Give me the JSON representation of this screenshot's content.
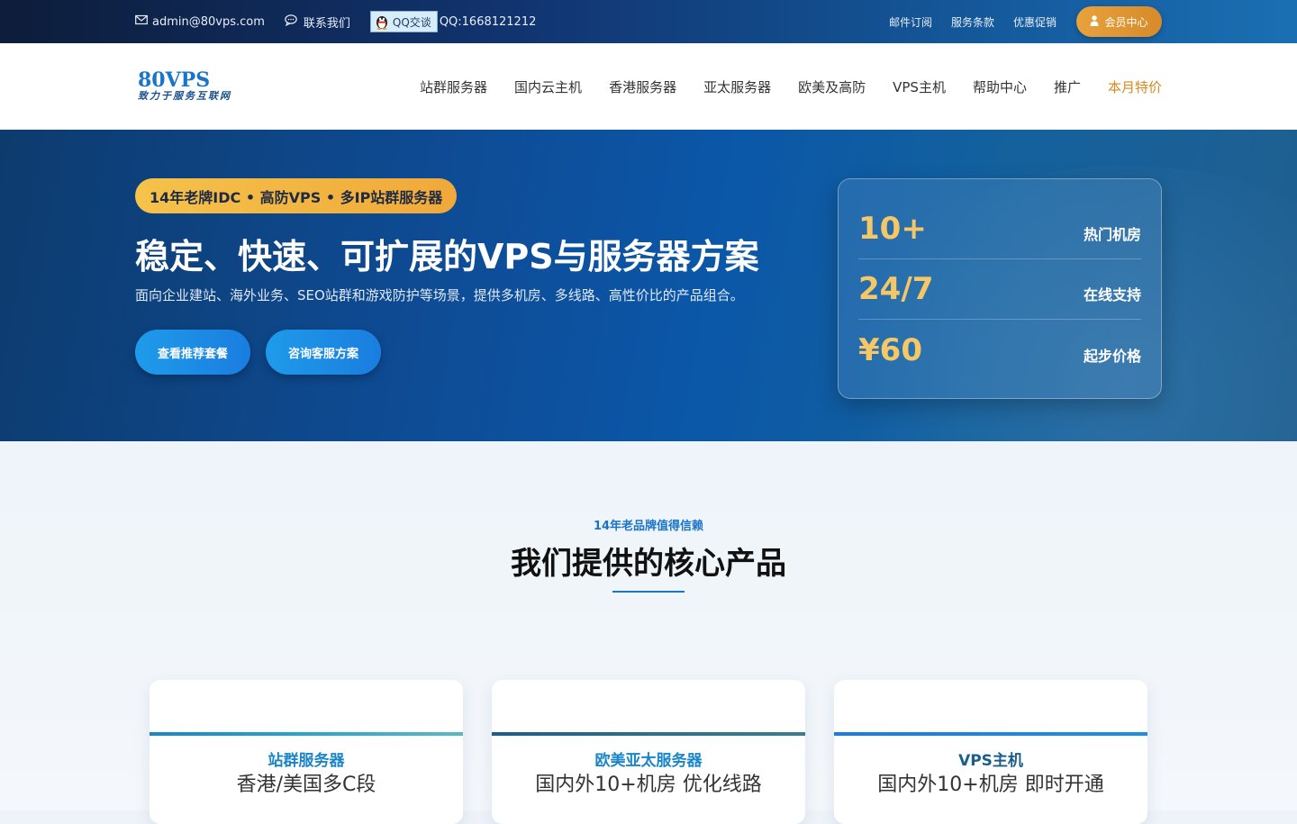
{
  "topbar": {
    "email": "admin@80vps.com",
    "contact": "联系我们",
    "qq_button": "QQ交谈",
    "qq_number": "QQ:1668121212",
    "links": [
      "邮件订阅",
      "服务条款",
      "优惠促销"
    ],
    "member": "会员中心"
  },
  "nav": {
    "logo_brand": "80VPS",
    "logo_slogan": "致力于服务互联网",
    "menu": [
      "站群服务器",
      "国内云主机",
      "香港服务器",
      "亚太服务器",
      "欧美及高防",
      "VPS主机",
      "帮助中心",
      "推广",
      "本月特价"
    ]
  },
  "hero": {
    "badge": "14年老牌IDC • 高防VPS • 多IP站群服务器",
    "title": "稳定、快速、可扩展的VPS与服务器方案",
    "description": "面向企业建站、海外业务、SEO站群和游戏防护等场景，提供多机房、多线路、高性价比的产品组合。",
    "btn_primary": "查看推荐套餐",
    "btn_secondary": "咨询客服方案",
    "stats": [
      {
        "num": "10+",
        "label": "热门机房"
      },
      {
        "num": "24/7",
        "label": "在线支持"
      },
      {
        "num": "¥60",
        "label": "起步价格"
      }
    ]
  },
  "products": {
    "kicker": "14年老品牌值得信赖",
    "heading": "我们提供的核心产品",
    "cards": [
      {
        "title": "站群服务器",
        "subtitle": "香港/美国多C段",
        "color": "#1a86c7"
      },
      {
        "title": "欧美亚太服务器",
        "subtitle": "国内外10+机房 优化线路",
        "color": "#1a86c7"
      },
      {
        "title": "VPS主机",
        "subtitle": "国内外10+机房 即时开通",
        "color": "#1b5d8c"
      }
    ]
  },
  "colors": {
    "accent": "#1a74c9",
    "gold": "#f6c766",
    "member_btn": "#e8a23c",
    "special_menu": "#d9891f"
  }
}
